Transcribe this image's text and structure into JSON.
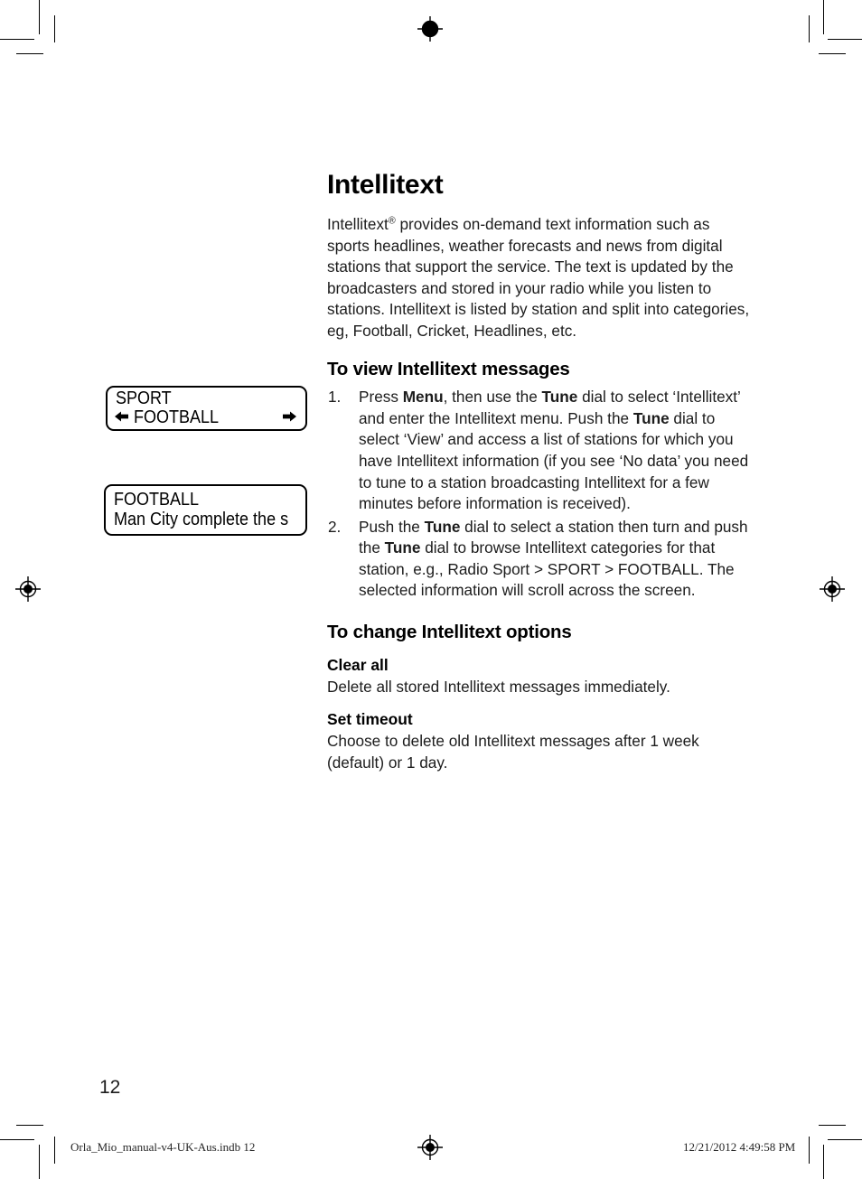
{
  "page": {
    "number": "12",
    "title": "Intellitext"
  },
  "intro": {
    "text_before_sup": "Intellitext",
    "sup": "®",
    "text_after_sup": " provides on-demand text information such as sports headlines, weather forecasts and news from digital stations that support the service. The text is updated by the broadcasters and stored in your radio while you listen to stations. Intellitext is listed by station and split into categories, eg, Football, Cricket, Headlines, etc."
  },
  "view_section": {
    "heading": "To view Intellitext messages",
    "steps": [
      {
        "number": "1.",
        "part1": "Press ",
        "bold1": "Menu",
        "part2": ", then use the ",
        "bold2": "Tune",
        "part3": " dial to select ‘Intellitext’ and enter the Intellitext menu. Push the ",
        "bold3": "Tune",
        "part4": " dial to select ‘View’ and access a list of stations for which you have Intellitext information (if you see ‘No data’ you need to tune to a station broadcasting Intellitext for a few minutes before information is received)."
      },
      {
        "number": "2.",
        "part1": "Push the ",
        "bold1": "Tune",
        "part2": " dial to select a station then turn and push the ",
        "bold2": "Tune",
        "part3": " dial to browse Intellitext categories for that station, e.g., Radio Sport > SPORT > FOOTBALL. The selected information will scroll across the screen.",
        "bold3": "",
        "part4": ""
      }
    ]
  },
  "options_section": {
    "heading": "To change Intellitext options",
    "items": [
      {
        "label": "Clear all",
        "description": "Delete all stored Intellitext messages immediately."
      },
      {
        "label": "Set timeout",
        "description": "Choose to delete old Intellitext messages after 1 week (default) or 1 day."
      }
    ]
  },
  "lcd_displays": [
    {
      "name": "sport-football-display",
      "line1": "SPORT",
      "line2": "FOOTBALL",
      "arrow_left": "←",
      "arrow_right": "→"
    },
    {
      "name": "football-headline-display",
      "line1": "FOOTBALL",
      "line2": "Man City complete the s"
    }
  ],
  "footer": {
    "left": "Orla_Mio_manual-v4-UK-Aus.indb   12",
    "right": "12/21/2012   4:49:58 PM"
  },
  "colors": {
    "ink": "#000000",
    "body_text": "#1c1c1c",
    "paper": "#ffffff"
  }
}
